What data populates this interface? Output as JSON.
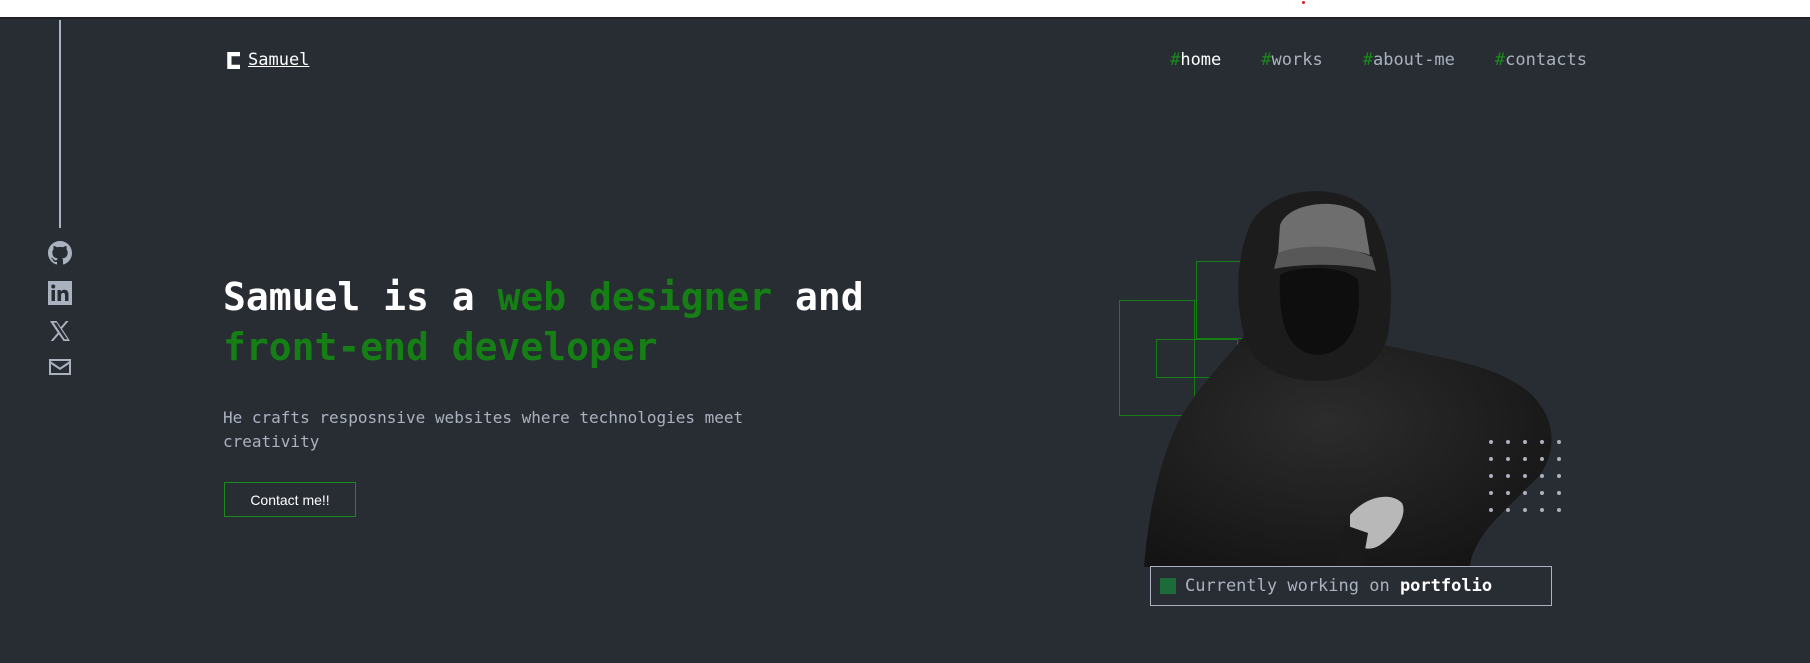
{
  "header": {
    "logo_text": "Samuel",
    "nav": [
      {
        "hash": "#",
        "label": "home",
        "active": true
      },
      {
        "hash": "#",
        "label": "works",
        "active": false
      },
      {
        "hash": "#",
        "label": "about-me",
        "active": false
      },
      {
        "hash": "#",
        "label": "contacts",
        "active": false
      }
    ]
  },
  "social": [
    "github-icon",
    "linkedin-icon",
    "x-icon",
    "email-icon"
  ],
  "hero": {
    "part1": "Samuel is a ",
    "part2": "web designer",
    "part3": " and",
    "part4": "front-end developer",
    "subtitle": "He crafts resposnsive websites where technologies meet creativity",
    "button": "Contact me!!"
  },
  "status": {
    "prefix": "Currently working on ",
    "project": "portfolio"
  },
  "colors": {
    "background": "#282c33",
    "accent": "#157f15",
    "text": "#abb2bf"
  }
}
